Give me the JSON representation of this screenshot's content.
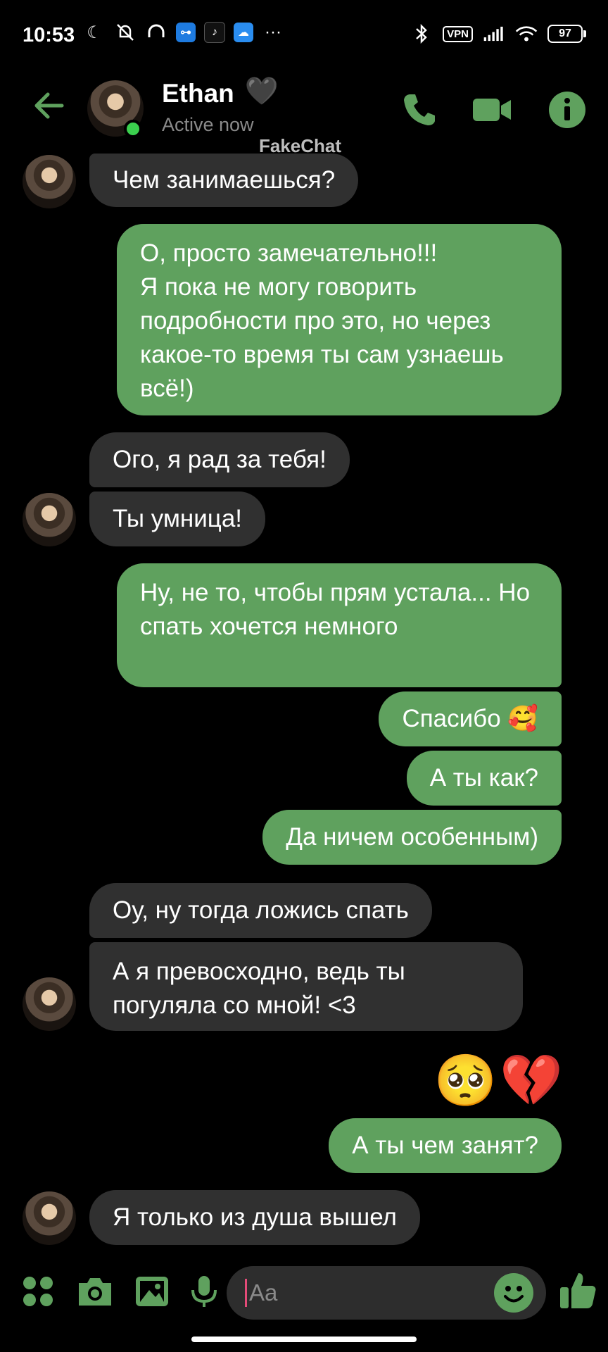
{
  "status_bar": {
    "time": "10:53",
    "vpn_label": "VPN",
    "battery": "97",
    "more": "···"
  },
  "header": {
    "name": "Ethan",
    "name_emoji": "🖤",
    "status": "Active now",
    "watermark": "FakeChat",
    "accent": "#5fa15e"
  },
  "messages": [
    {
      "side": "in",
      "text": "Чем занимаешься?"
    },
    {
      "side": "out",
      "text": "О, просто замечательно!!!\nЯ пока не могу говорить подробности про это, но через какое-то время ты сам узнаешь всё!)"
    },
    {
      "side": "in",
      "text": "Ого, я рад за тебя!"
    },
    {
      "side": "in",
      "text": "Ты умница!"
    },
    {
      "side": "out",
      "text": "Ну, не то, чтобы прям устала... Но спать хочется немного"
    },
    {
      "side": "out",
      "text": "Спасибо 🥰"
    },
    {
      "side": "out",
      "text": "А ты как?"
    },
    {
      "side": "out",
      "text": "Да ничем особенным)"
    },
    {
      "side": "in",
      "text": "Оу, ну тогда ложись спать"
    },
    {
      "side": "in",
      "text": "А я превосходно, ведь ты погуляла со мной! <3"
    },
    {
      "side": "out",
      "text": "🥺💔"
    },
    {
      "side": "out",
      "text": "А ты чем занят?"
    },
    {
      "side": "in",
      "text": "Я только из душа вышел"
    }
  ],
  "composer": {
    "placeholder": "Aa"
  }
}
